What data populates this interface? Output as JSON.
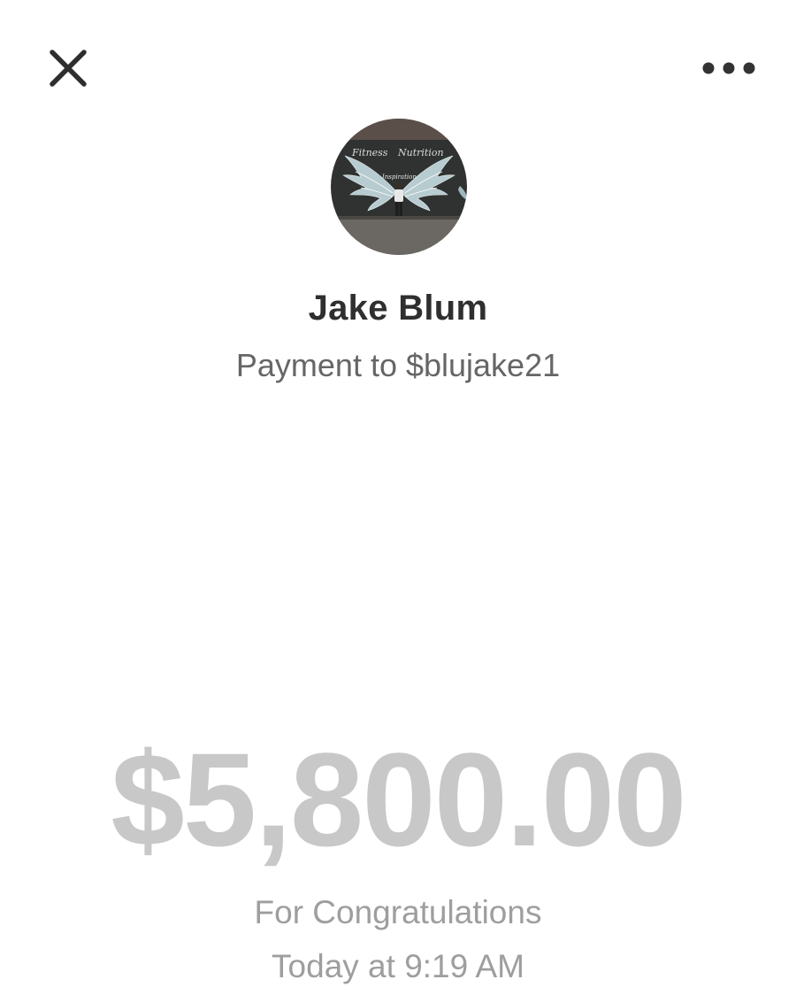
{
  "header": {
    "close_icon": "close-icon",
    "more_icon": "more-horizontal-icon"
  },
  "recipient": {
    "name": "Jake Blum",
    "payment_line": "Payment to $blujake21",
    "avatar_text_top": "Fitness",
    "avatar_text_mid": "Nutrition",
    "avatar_text_wings": "Inspiration"
  },
  "payment": {
    "amount": "$5,800.00",
    "note": "For Congratulations",
    "time": "Today at 9:19 AM"
  },
  "colors": {
    "amount": "#c8c8c8",
    "name": "#2f2f2f",
    "secondary": "#9e9e9e"
  }
}
